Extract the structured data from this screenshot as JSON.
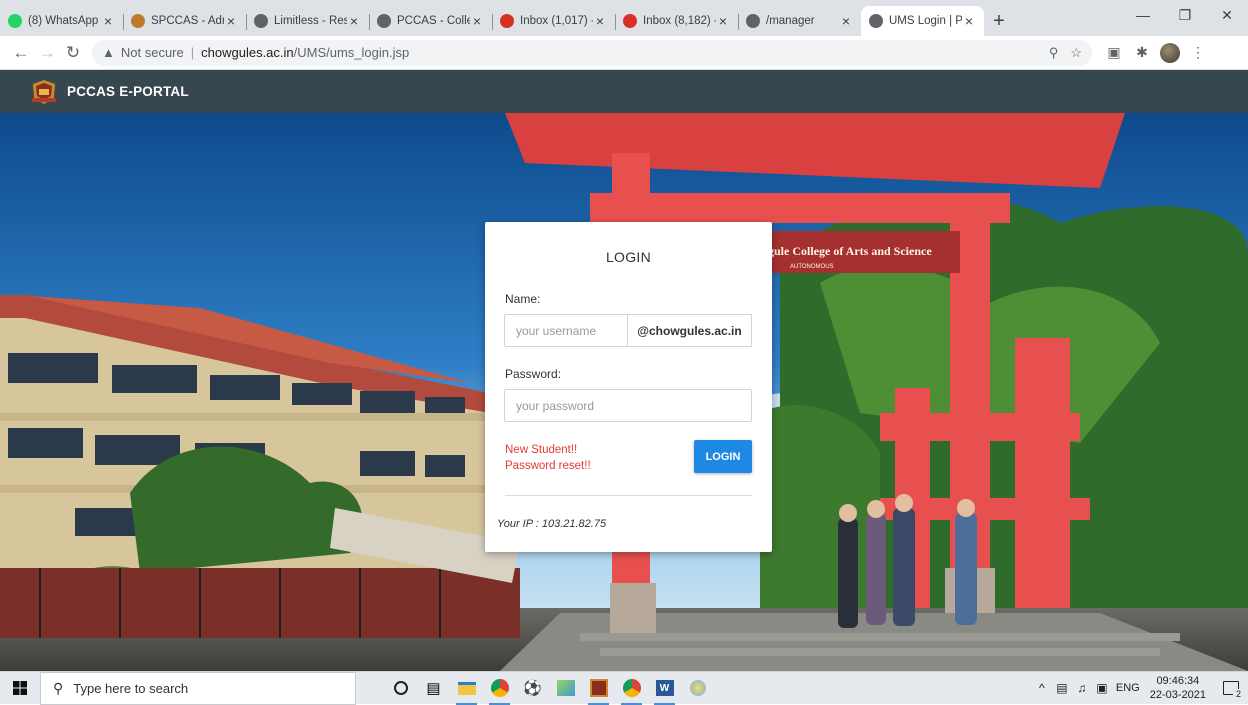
{
  "browser": {
    "tabs": [
      {
        "title": "(8) WhatsApp",
        "icon": "whatsapp-icon",
        "color": "#25d366",
        "active": false
      },
      {
        "title": "SPCCAS - Adm",
        "icon": "college-crest-icon",
        "color": "#c07a2c",
        "active": false
      },
      {
        "title": "Limitless - Res",
        "icon": "globe-icon",
        "color": "#5f6368",
        "active": false
      },
      {
        "title": "PCCAS - Colle",
        "icon": "globe-icon",
        "color": "#5f6368",
        "active": false
      },
      {
        "title": "Inbox (1,017) -",
        "icon": "gmail-icon",
        "color": "#d93025",
        "active": false
      },
      {
        "title": "Inbox (8,182) -",
        "icon": "gmail-icon",
        "color": "#d93025",
        "active": false
      },
      {
        "title": "/manager",
        "icon": "globe-icon",
        "color": "#5f6368",
        "active": false
      },
      {
        "title": "UMS Login | P",
        "icon": "globe-icon",
        "color": "#5f6368",
        "active": true
      }
    ],
    "security_text": "Not secure",
    "url_host": "chowgules.ac.in",
    "url_path": "/UMS/ums_login.jsp"
  },
  "site": {
    "brand": "PCCAS E-PORTAL",
    "arch_sign": "gule College of Arts and Science",
    "arch_sign_sub": "AUTONOMOUS"
  },
  "login": {
    "title": "LOGIN",
    "name_label": "Name:",
    "username_placeholder": "your username",
    "domain_suffix": "@chowgules.ac.in",
    "password_label": "Password:",
    "password_placeholder": "your password",
    "new_student_link": "New Student!!",
    "password_reset_link": "Password reset!!",
    "submit_label": "LOGIN",
    "ip_text": "Your IP : 103.21.82.75"
  },
  "taskbar": {
    "search_placeholder": "Type here to search",
    "apps": [
      "cortana-icon",
      "task-view-icon",
      "file-explorer-icon",
      "chrome-icon",
      "soccer-ball-icon",
      "paint-icon",
      "crest-app-icon",
      "chrome-alt-icon",
      "word-icon",
      "paint3d-icon"
    ],
    "language": "ENG",
    "time": "09:46:34",
    "date": "22-03-2021",
    "notification_count": "2"
  },
  "colors": {
    "header_bg": "#37474f",
    "login_button": "#1e88e5",
    "link_red": "#e53935",
    "arch_red": "#e8504f"
  }
}
